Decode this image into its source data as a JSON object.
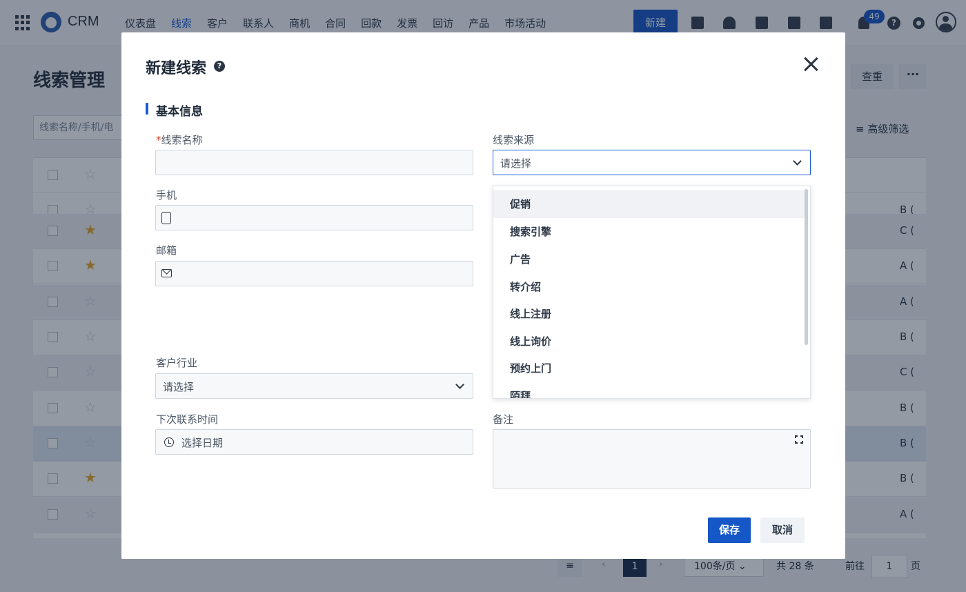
{
  "app": {
    "name": "CRM"
  },
  "nav": {
    "items": [
      "仪表盘",
      "线索",
      "客户",
      "联系人",
      "商机",
      "合同",
      "回款",
      "发票",
      "回访",
      "产品",
      "市场活动"
    ],
    "active_index": 1,
    "new_label": "新建",
    "notification_count": "49"
  },
  "page": {
    "title": "线索管理",
    "search_placeholder": "线索名称/手机/电",
    "dedupe_label": "查重",
    "more_label": "···",
    "advanced_filter_label": "高级筛选",
    "rows": [
      {
        "starred": false,
        "grade": "B ("
      },
      {
        "starred": true,
        "grade": "C ("
      },
      {
        "starred": true,
        "grade": "A ("
      },
      {
        "starred": false,
        "grade": "A ("
      },
      {
        "starred": false,
        "grade": "B ("
      },
      {
        "starred": false,
        "grade": "C ("
      },
      {
        "starred": false,
        "grade": "B ("
      },
      {
        "starred": false,
        "grade": "B ("
      },
      {
        "starred": true,
        "grade": "B ("
      },
      {
        "starred": false,
        "grade": "A ("
      }
    ],
    "pagination": {
      "current_page": "1",
      "page_size": "100条/页",
      "total": "共 28 条",
      "goto_label": "前往",
      "goto_value": "1",
      "page_unit": "页"
    }
  },
  "modal": {
    "title": "新建线索",
    "section_title": "基本信息",
    "fields": {
      "lead_name": {
        "label": "线索名称",
        "required": "*",
        "value": ""
      },
      "lead_source": {
        "label": "线索来源",
        "value": "请选择"
      },
      "mobile": {
        "label": "手机",
        "value": ""
      },
      "email": {
        "label": "邮箱",
        "value": ""
      },
      "industry": {
        "label": "客户行业",
        "value": "请选择"
      },
      "next_contact": {
        "label": "下次联系时间",
        "placeholder": "选择日期"
      },
      "remarks": {
        "label": "备注",
        "value": ""
      }
    },
    "source_options": [
      "促销",
      "搜索引擎",
      "广告",
      "转介绍",
      "线上注册",
      "线上询价",
      "预约上门",
      "陌拜"
    ],
    "hovered_option_index": 0,
    "save_label": "保存",
    "cancel_label": "取消"
  },
  "colors": {
    "primary": "#1657c7",
    "required": "#e2412d",
    "star": "#e6a72a"
  }
}
